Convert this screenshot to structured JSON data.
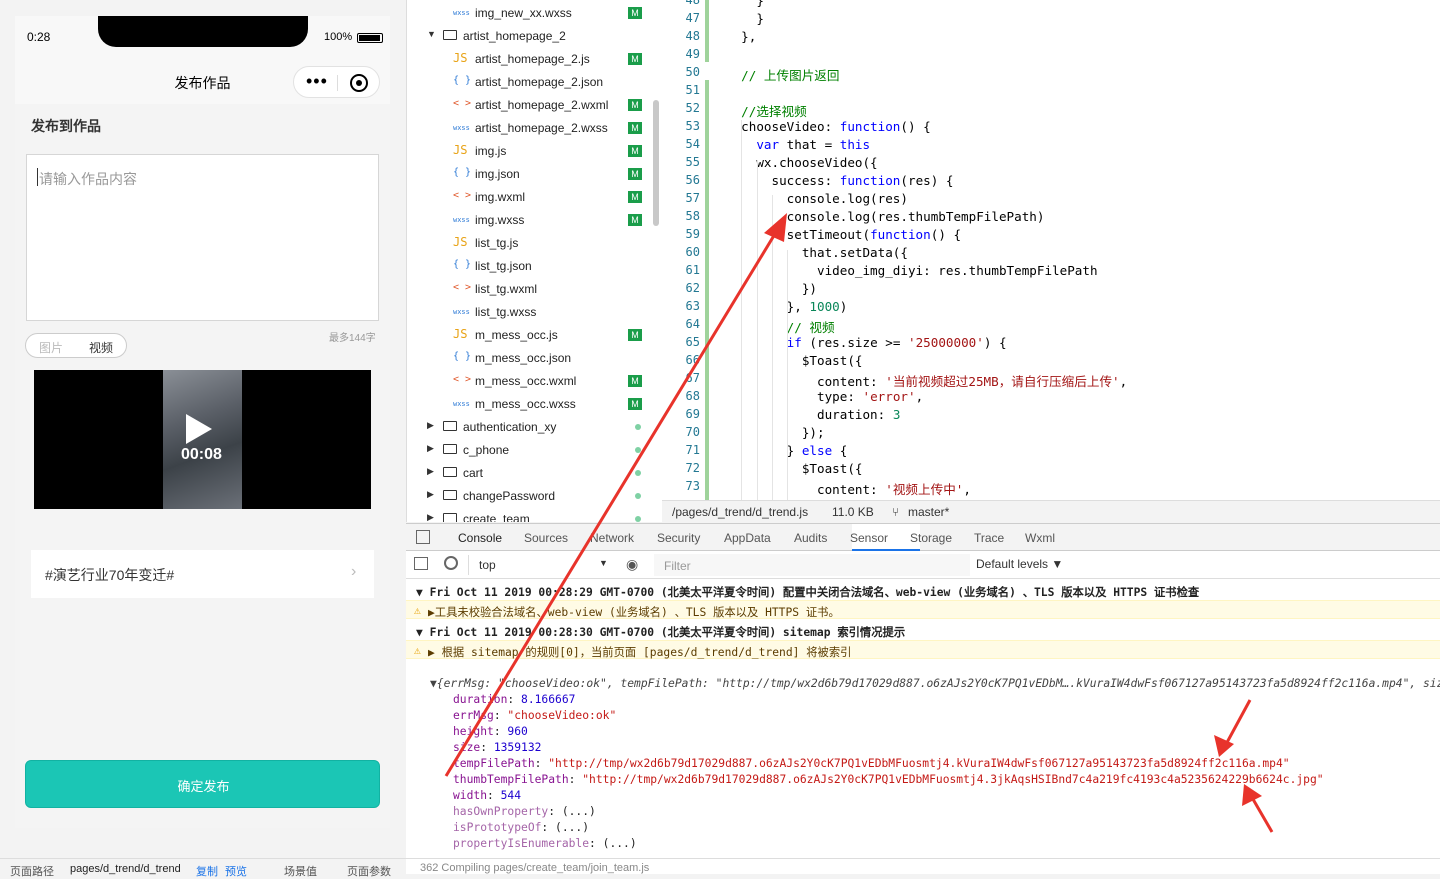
{
  "simulator": {
    "status_time": "0:28",
    "battery": "100%",
    "nav_title": "发布作品",
    "section_title": "发布到作品",
    "placeholder": "请输入作品内容",
    "char_limit": "最多144字",
    "tab_image": "图片",
    "tab_video": "视频",
    "video_duration": "00:08",
    "topic": "#演艺行业70年变迁#",
    "submit": "确定发布",
    "footer": [
      "页面路径",
      "pages/d_trend/d_trend",
      "复制",
      "预览",
      "场景值",
      "页面参数"
    ]
  },
  "file_tree": [
    {
      "type": "wxss",
      "icon": "wxss",
      "name": "img_new_xx.wxss",
      "badge": "M"
    },
    {
      "type": "folder",
      "icon": "folder-open",
      "name": "artist_homepage_2",
      "badge": ""
    },
    {
      "type": "js",
      "icon": "JS",
      "name": "artist_homepage_2.js",
      "badge": "M"
    },
    {
      "type": "json",
      "icon": "{ }",
      "name": "artist_homepage_2.json",
      "badge": ""
    },
    {
      "type": "wxml",
      "icon": "< >",
      "name": "artist_homepage_2.wxml",
      "badge": "M"
    },
    {
      "type": "wxss",
      "icon": "wxss",
      "name": "artist_homepage_2.wxss",
      "badge": "M"
    },
    {
      "type": "js",
      "icon": "JS",
      "name": "img.js",
      "badge": "M"
    },
    {
      "type": "json",
      "icon": "{ }",
      "name": "img.json",
      "badge": "M"
    },
    {
      "type": "wxml",
      "icon": "< >",
      "name": "img.wxml",
      "badge": "M"
    },
    {
      "type": "wxss",
      "icon": "wxss",
      "name": "img.wxss",
      "badge": "M"
    },
    {
      "type": "js",
      "icon": "JS",
      "name": "list_tg.js",
      "badge": ""
    },
    {
      "type": "json",
      "icon": "{ }",
      "name": "list_tg.json",
      "badge": ""
    },
    {
      "type": "wxml",
      "icon": "< >",
      "name": "list_tg.wxml",
      "badge": ""
    },
    {
      "type": "wxss",
      "icon": "wxss",
      "name": "list_tg.wxss",
      "badge": ""
    },
    {
      "type": "js",
      "icon": "JS",
      "name": "m_mess_occ.js",
      "badge": "M"
    },
    {
      "type": "json",
      "icon": "{ }",
      "name": "m_mess_occ.json",
      "badge": ""
    },
    {
      "type": "wxml",
      "icon": "< >",
      "name": "m_mess_occ.wxml",
      "badge": "M"
    },
    {
      "type": "wxss",
      "icon": "wxss",
      "name": "m_mess_occ.wxss",
      "badge": "M"
    },
    {
      "type": "folder",
      "icon": "folder-closed",
      "name": "authentication_xy",
      "badge": "dot"
    },
    {
      "type": "folder",
      "icon": "folder-closed",
      "name": "c_phone",
      "badge": "dot"
    },
    {
      "type": "folder",
      "icon": "folder-closed",
      "name": "cart",
      "badge": "dot"
    },
    {
      "type": "folder",
      "icon": "folder-closed",
      "name": "changePassword",
      "badge": "dot"
    },
    {
      "type": "folder",
      "icon": "folder-closed",
      "name": "create_team",
      "badge": "dot"
    }
  ],
  "editor": {
    "lines": [
      {
        "n": "48",
        "t": "    }"
      },
      {
        "n": "47",
        "t": "    }"
      },
      {
        "n": "48",
        "t": "  },"
      },
      {
        "n": "49",
        "t": ""
      },
      {
        "n": "50",
        "t": "  // 上传图片返回"
      },
      {
        "n": "51",
        "t": ""
      },
      {
        "n": "52",
        "t": "  //选择视频"
      },
      {
        "n": "53",
        "t": "  chooseVideo: function() {"
      },
      {
        "n": "54",
        "t": "    var that = this"
      },
      {
        "n": "55",
        "t": "    wx.chooseVideo({"
      },
      {
        "n": "56",
        "t": "      success: function(res) {"
      },
      {
        "n": "57",
        "t": "        console.log(res)"
      },
      {
        "n": "58",
        "t": "        console.log(res.thumbTempFilePath)"
      },
      {
        "n": "59",
        "t": "        setTimeout(function() {"
      },
      {
        "n": "60",
        "t": "          that.setData({"
      },
      {
        "n": "61",
        "t": "            video_img_diyi: res.thumbTempFilePath"
      },
      {
        "n": "62",
        "t": "          })"
      },
      {
        "n": "63",
        "t": "        }, 1000)"
      },
      {
        "n": "64",
        "t": "        // 视频"
      },
      {
        "n": "65",
        "t": "        if (res.size >= '25000000') {"
      },
      {
        "n": "66",
        "t": "          $Toast({"
      },
      {
        "n": "67",
        "t": "            content: '当前视频超过25MB，请自行压缩后上传',"
      },
      {
        "n": "68",
        "t": "            type: 'error',"
      },
      {
        "n": "69",
        "t": "            duration: 3"
      },
      {
        "n": "70",
        "t": "          });"
      },
      {
        "n": "71",
        "t": "        } else {"
      },
      {
        "n": "72",
        "t": "          $Toast({"
      },
      {
        "n": "73",
        "t": "            content: '视频上传中',"
      }
    ],
    "status_path": "/pages/d_trend/d_trend.js",
    "status_size": "11.0 KB",
    "status_branch": "master*"
  },
  "devtools": {
    "tabs": [
      "Console",
      "Sources",
      "Network",
      "Security",
      "AppData",
      "Audits",
      "Sensor",
      "Storage",
      "Trace",
      "Wxml"
    ],
    "context": "top",
    "filter_placeholder": "Filter",
    "levels": "Default levels ▼",
    "logs": [
      {
        "kind": "group",
        "text": "▼ Fri Oct 11 2019 00:28:29 GMT-0700 (北美太平洋夏令时间) 配置中关闭合法域名、web-view (业务域名) 、TLS 版本以及 HTTPS 证书检查"
      },
      {
        "kind": "warn",
        "text": "▶工具未校验合法域名、web-view (业务域名) 、TLS 版本以及 HTTPS 证书。"
      },
      {
        "kind": "group",
        "text": "▼ Fri Oct 11 2019 00:28:30 GMT-0700 (北美太平洋夏令时间) sitemap 索引情况提示"
      },
      {
        "kind": "warn",
        "text": "▶ 根据 sitemap 的规则[0]，当前页面 [pages/d_trend/d_trend] 将被索引"
      }
    ],
    "object_summary": "▼{errMsg: \"chooseVideo:ok\", tempFilePath: \"http://tmp/wx2d6b79d17029d887.o6zAJs2Y0cK7PQ1vEDbM….kVuraIW4dwFsf067127a95143723fa5d8924ff2c116a.mp4\", size: 1",
    "props": [
      {
        "k": "duration",
        "v": "8.166667",
        "t": "num"
      },
      {
        "k": "errMsg",
        "v": "\"chooseVideo:ok\"",
        "t": "str"
      },
      {
        "k": "height",
        "v": "960",
        "t": "num"
      },
      {
        "k": "size",
        "v": "1359132",
        "t": "num"
      },
      {
        "k": "tempFilePath",
        "v": "\"http://tmp/wx2d6b79d17029d887.o6zAJs2Y0cK7PQ1vEDbMFuosmtj4.kVuraIW4dwFsf067127a95143723fa5d8924ff2c116a.mp4\"",
        "t": "str"
      },
      {
        "k": "thumbTempFilePath",
        "v": "\"http://tmp/wx2d6b79d17029d887.o6zAJs2Y0cK7PQ1vEDbMFuosmtj4.3jkAqsHSIBnd7c4a219fc4193c4a5235624229b6624c.jpg\"",
        "t": "str"
      },
      {
        "k": "width",
        "v": "544",
        "t": "num"
      },
      {
        "k": "hasOwnProperty",
        "v": "(...)",
        "t": "faded"
      },
      {
        "k": "isPrototypeOf",
        "v": "(...)",
        "t": "faded"
      },
      {
        "k": "propertyIsEnumerable",
        "v": "(...)",
        "t": "faded"
      }
    ],
    "footer": "362 Compiling pages/create_team/join_team.js"
  },
  "colors": {
    "accent": "#1bc6b5",
    "arrow": "#e8332b",
    "git_badge": "#1a9d4a",
    "active_tab": "#1a73e8"
  }
}
